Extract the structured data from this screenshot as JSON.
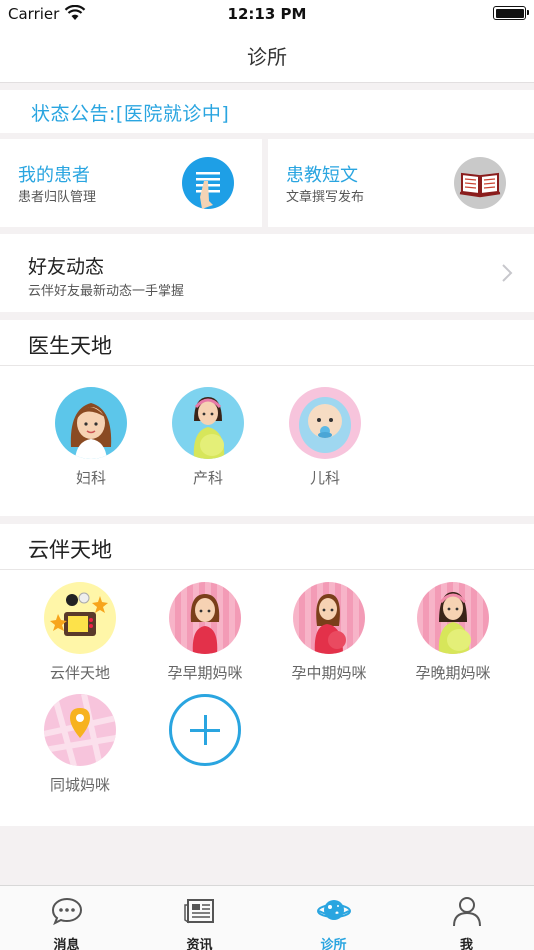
{
  "status_bar": {
    "carrier": "Carrier",
    "time": "12:13 PM"
  },
  "nav": {
    "title": "诊所"
  },
  "notice": {
    "text": "状态公告:[医院就诊中]"
  },
  "cards": [
    {
      "title": "我的患者",
      "subtitle": "患者归队管理",
      "icon": "list-hand-icon",
      "color": "#1e9fe6"
    },
    {
      "title": "患教短文",
      "subtitle": "文章撰写发布",
      "icon": "book-icon",
      "color": "#c9c9c9"
    }
  ],
  "friends": {
    "title": "好友动态",
    "subtitle": "云伴好友最新动态一手掌握"
  },
  "doctor_section": {
    "title": "医生天地",
    "items": [
      {
        "label": "妇科",
        "icon": "woman-avatar-icon"
      },
      {
        "label": "产科",
        "icon": "pregnant-woman-avatar-icon"
      },
      {
        "label": "儿科",
        "icon": "baby-avatar-icon"
      }
    ]
  },
  "cloud_section": {
    "title": "云伴天地",
    "items": [
      {
        "label": "云伴天地",
        "icon": "tv-stars-icon"
      },
      {
        "label": "孕早期妈咪",
        "icon": "early-pregnancy-mom-icon"
      },
      {
        "label": "孕中期妈咪",
        "icon": "mid-pregnancy-mom-icon"
      },
      {
        "label": "孕晚期妈咪",
        "icon": "late-pregnancy-mom-icon"
      },
      {
        "label": "同城妈咪",
        "icon": "map-pin-icon"
      }
    ],
    "add_icon": "add-icon"
  },
  "tabs": [
    {
      "label": "消息",
      "icon": "chat-bubble-icon",
      "active": false
    },
    {
      "label": "资讯",
      "icon": "newspaper-icon",
      "active": false
    },
    {
      "label": "诊所",
      "icon": "clinic-planet-icon",
      "active": true
    },
    {
      "label": "我",
      "icon": "person-icon",
      "active": false
    }
  ],
  "colors": {
    "accent": "#2aa5e0",
    "background": "#f4f1f2"
  }
}
